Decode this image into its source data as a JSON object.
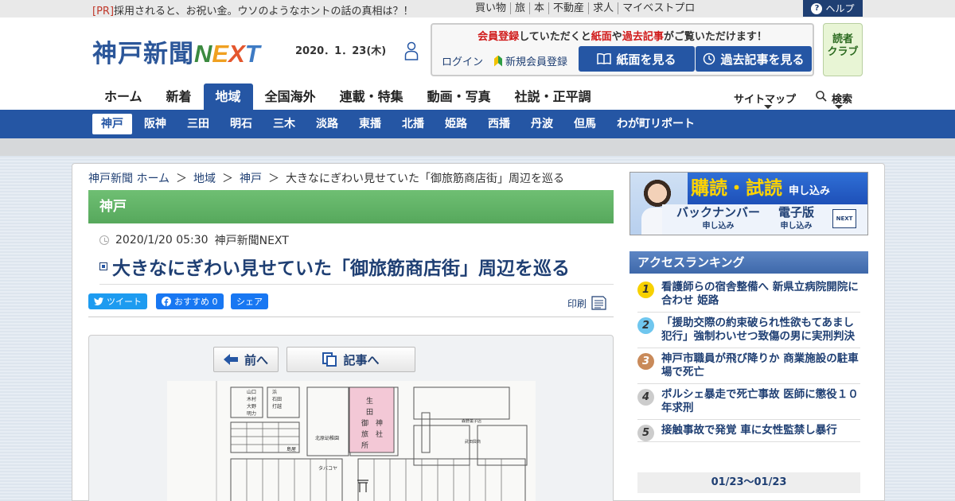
{
  "top": {
    "pr_tag": "[PR]",
    "pr_text": "採用されると、お祝い金。ウソのようなホントの話の真相は？！",
    "links": [
      "買い物",
      "旅",
      "本",
      "不動産",
      "求人",
      "マイベストプロ"
    ],
    "help_label": "ヘルプ"
  },
  "header": {
    "logo_main": "神戸新聞",
    "logo_next": [
      "N",
      "E",
      "X",
      "T"
    ],
    "date": "2020．1．23(木)",
    "notice_parts": [
      "会員登録",
      "していただくと",
      "紙面",
      "や",
      "過去記事",
      "がご覧いただけます！"
    ],
    "login": "ログイン",
    "new_member": "新規会員登録",
    "view_paper": "紙面を見る",
    "view_past": "過去記事を見る",
    "readers_club": [
      "読者",
      "クラブ"
    ]
  },
  "mainnav": {
    "items": [
      "ホーム",
      "新着",
      "地域",
      "全国海外",
      "連載・特集",
      "動画・写真",
      "社説・正平調"
    ],
    "active_index": 2,
    "sitemap": "サイトマップ",
    "search": "検索"
  },
  "subnav": {
    "items": [
      "神戸",
      "阪神",
      "三田",
      "明石",
      "三木",
      "淡路",
      "東播",
      "北播",
      "姫路",
      "西播",
      "丹波",
      "但馬",
      "わが町リポート"
    ],
    "active_index": 0
  },
  "breadcrumb": [
    "神戸新聞 ホーム",
    "地域",
    "神戸",
    "大きなにぎわい見せていた「御旅筋商店街」周辺を巡る"
  ],
  "article": {
    "category": "神戸",
    "datetime": "2020/1/20 05:30",
    "source": "神戸新聞NEXT",
    "title": "大きなにぎわい見せていた「御旅筋商店街」周辺を巡る",
    "tweet": "ツイート",
    "recommend": "おすすめ 0",
    "share": "シェア",
    "print": "印刷",
    "prev_button": "前へ",
    "article_button": "記事へ"
  },
  "map_labels": {
    "shrine": [
      "生",
      "田",
      "神",
      "社"
    ],
    "otabisho": [
      "御",
      "旅",
      "所"
    ],
    "kindergarten": "北原幼稚園",
    "shops_a": [
      "山口",
      "木村",
      "大野",
      "明力"
    ],
    "shops_b": [
      "浜",
      "石田",
      "打越"
    ],
    "misc": [
      "森野菓子店",
      "武田興商",
      "島屋",
      "タバコヤ"
    ]
  },
  "sidebar": {
    "ad_top": "購読・試読",
    "ad_top_small": "申し込み",
    "ad_backnumber": "バックナンバー",
    "ad_edition": "電子版",
    "ad_apply": "申し込み",
    "ad_next": "NEXT",
    "ranking_title": "アクセスランキング",
    "ranking": [
      {
        "rank": "1",
        "text": "看護師らの宿舎整備へ 新県立病院開院に合わせ 姫路"
      },
      {
        "rank": "2",
        "text": "「援助交際の約束破られ性欲もてあまし犯行」強制わいせつ致傷の男に実刑判決"
      },
      {
        "rank": "3",
        "text": "神戸市職員が飛び降りか 商業施設の駐車場で死亡"
      },
      {
        "rank": "4",
        "text": "ポルシェ暴走で死亡事故 医師に懲役１０年求刑"
      },
      {
        "rank": "5",
        "text": "接触事故で発覚 車に女性監禁し暴行"
      }
    ],
    "ranking_period": "01/23～01/23"
  },
  "colors": {
    "brand_blue": "#2556a4",
    "category_green": "#5fb365",
    "notice_red": "#d01a1a"
  }
}
